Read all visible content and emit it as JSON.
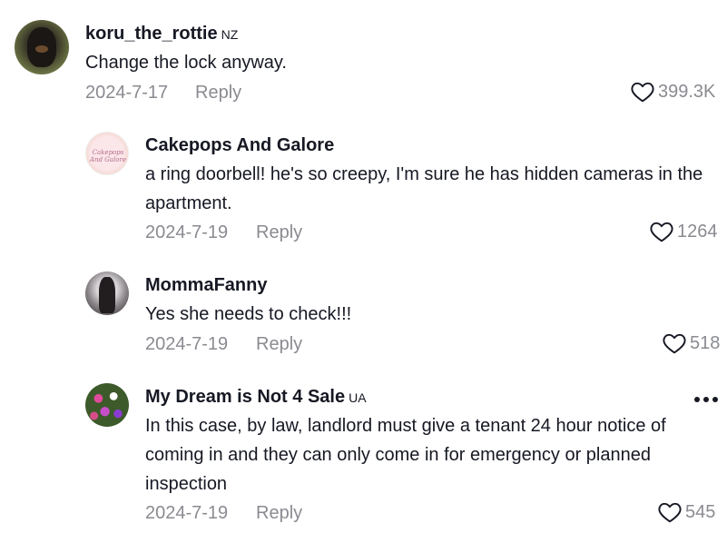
{
  "comments": [
    {
      "username": "koru_the_rottie",
      "flag": "NZ",
      "text": "Change the lock anyway.",
      "date": "2024-7-17",
      "reply_label": "Reply",
      "likes": "399.3K"
    },
    {
      "username": "Cakepops And Galore",
      "avatar_text": "Cakepops And Galore",
      "text": "a ring doorbell! he's so creepy, I'm sure he has hidden cameras in the apartment.",
      "date": "2024-7-19",
      "reply_label": "Reply",
      "likes": "1264"
    },
    {
      "username": "MommaFanny",
      "text": "Yes she needs to check!!!",
      "date": "2024-7-19",
      "reply_label": "Reply",
      "likes": "518"
    },
    {
      "username": "My Dream is Not 4 Sale",
      "flag": "UA",
      "text": "In this case, by law, landlord must give a tenant 24 hour notice of coming in and they can only come in for emergency or planned inspection",
      "date": "2024-7-19",
      "reply_label": "Reply",
      "likes": "545"
    }
  ],
  "icons": {
    "like": "heart-outline-icon",
    "more": "more-horizontal-icon"
  },
  "colors": {
    "text": "#161823",
    "muted": "#8a8b91",
    "background": "#ffffff"
  }
}
